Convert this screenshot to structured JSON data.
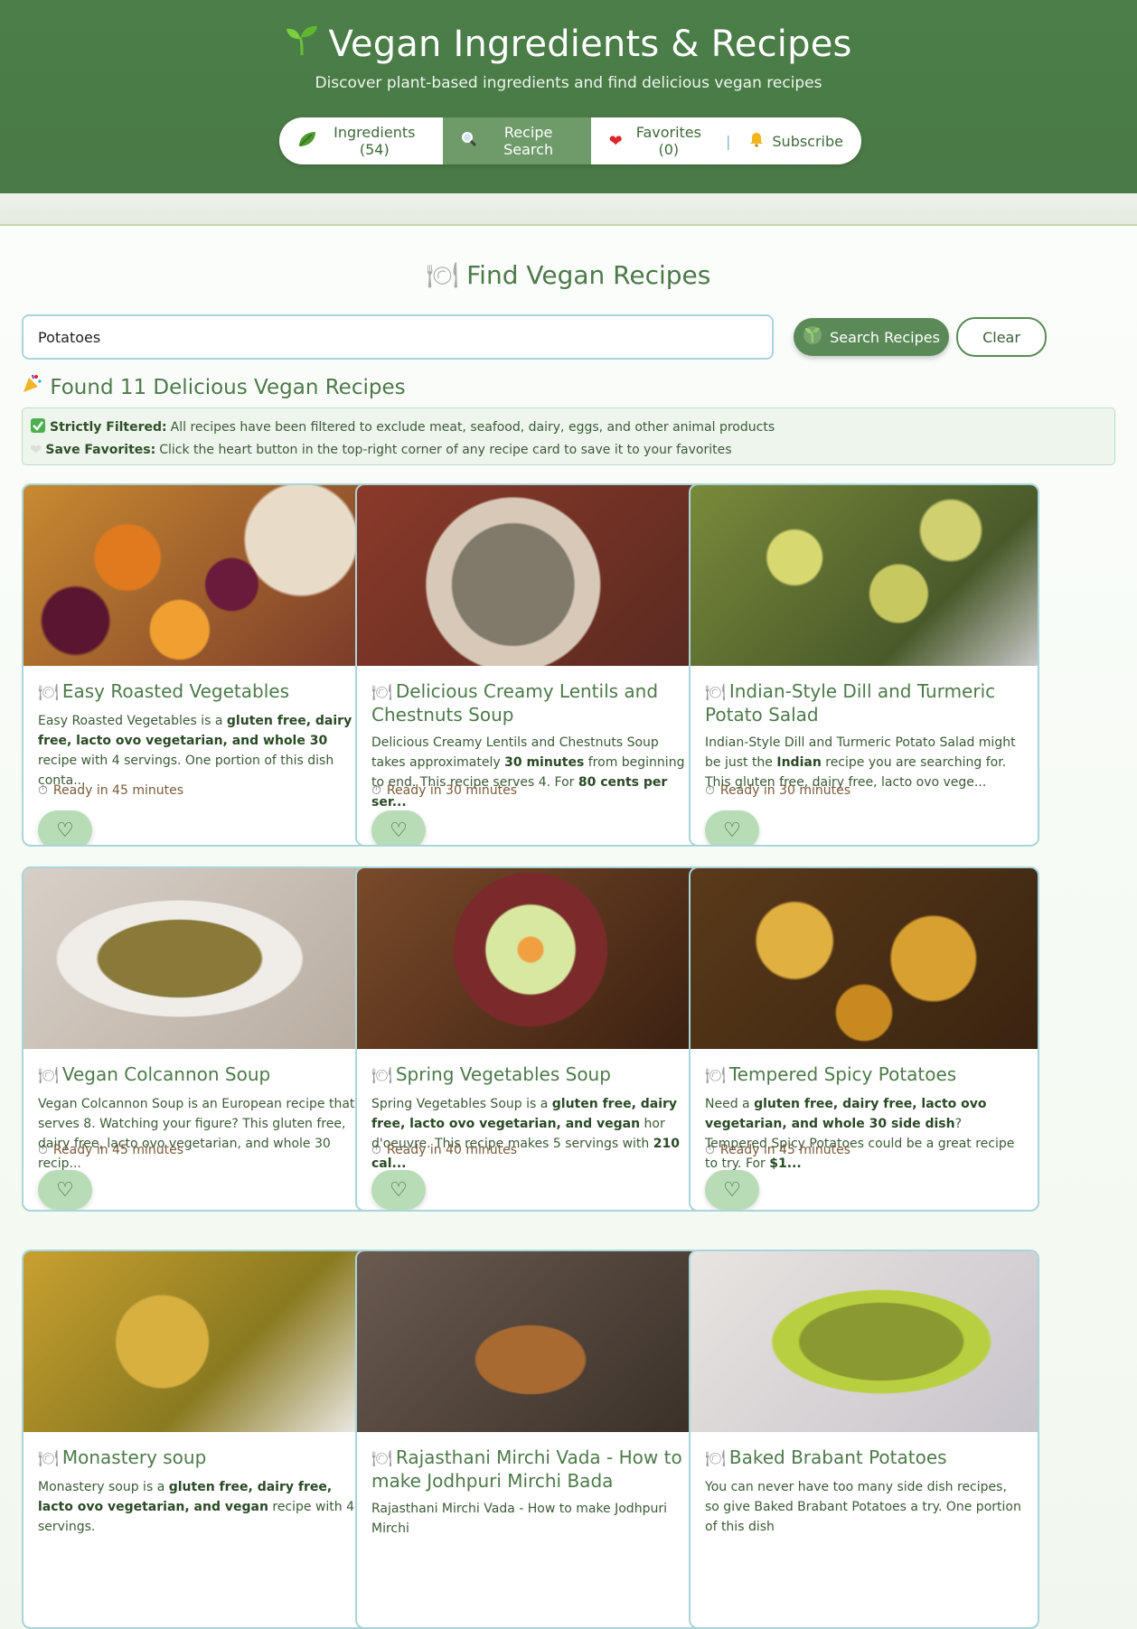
{
  "header": {
    "title_icon": "sprout-icon",
    "title": "Vegan Ingredients & Recipes",
    "subtitle": "Discover plant-based ingredients and find delicious vegan recipes",
    "nav": {
      "ingredients": "Ingredients (54)",
      "recipe_search": "Recipe Search",
      "favorites": "Favorites (0)",
      "separator": "|",
      "subscribe": "Subscribe"
    }
  },
  "search": {
    "heading": "Find Vegan Recipes",
    "value": "Potatoes",
    "search_button": "Search Recipes",
    "clear_button": "Clear"
  },
  "results": {
    "found": "Found 11 Delicious Vegan Recipes",
    "notice1_label": "Strictly Filtered:",
    "notice1_text": "All recipes have been filtered to exclude meat, seafood, dairy, eggs, and other animal products",
    "notice2_label": "Save Favorites:",
    "notice2_text": "Click the heart button in the top-right corner of any recipe card to save it to your favorites"
  },
  "recipes": [
    {
      "title": "Easy Roasted Vegetables",
      "time": "Ready in 45 minutes",
      "desc_html": "Easy Roasted Vegetables is a <b>gluten free, dairy free, lacto ovo vegetarian, and whole 30</b> recipe with 4 servings. One portion of this dish conta..."
    },
    {
      "title": "Delicious Creamy Lentils and Chestnuts Soup",
      "time": "Ready in 30 minutes",
      "desc_html": "Delicious Creamy Lentils and Chestnuts Soup takes approximately <b>30 minutes</b> from beginning to end. This recipe serves 4. For <b>80 cents per ser...</b>"
    },
    {
      "title": "Indian-Style Dill and Turmeric Potato Salad",
      "time": "Ready in 30 minutes",
      "desc_html": "Indian-Style Dill and Turmeric Potato Salad might be just the <b>Indian</b> recipe you are searching for. This gluten free, dairy free, lacto ovo vege..."
    },
    {
      "title": "Vegan Colcannon Soup",
      "time": "Ready in 45 minutes",
      "desc_html": "Vegan Colcannon Soup is an European recipe that serves 8. Watching your figure? This gluten free, dairy free, lacto ovo vegetarian, and whole 30 recip..."
    },
    {
      "title": "Spring Vegetables Soup",
      "time": "Ready in 40 minutes",
      "desc_html": "Spring Vegetables Soup is a <b>gluten free, dairy free, lacto ovo vegetarian, and vegan</b> hor d'oeuvre. This recipe makes 5 servings with <b>210 cal...</b>"
    },
    {
      "title": "Tempered Spicy Potatoes",
      "time": "Ready in 45 minutes",
      "desc_html": "Need a <b>gluten free, dairy free, lacto ovo vegetarian, and whole 30 side dish</b>? Tempered Spicy Potatoes could be a great recipe to try. For <b>$1...</b>"
    },
    {
      "title": "Monastery soup",
      "time": "",
      "desc_html": "Monastery soup is a <b>gluten free, dairy free, lacto ovo vegetarian, and vegan</b> recipe with 4 servings."
    },
    {
      "title": "Rajasthani Mirchi Vada - How to make Jodhpuri Mirchi Bada",
      "time": "",
      "desc_html": "Rajasthani Mirchi Vada - How to make Jodhpuri Mirchi"
    },
    {
      "title": "Baked Brabant Potatoes",
      "time": "",
      "desc_html": "You can never have too many side dish recipes, so give Baked Brabant Potatoes a try. One portion of this dish"
    }
  ],
  "colors": {
    "header": "#4b7e48",
    "accent": "#5b8a58",
    "card_border": "#a9d4d8"
  }
}
